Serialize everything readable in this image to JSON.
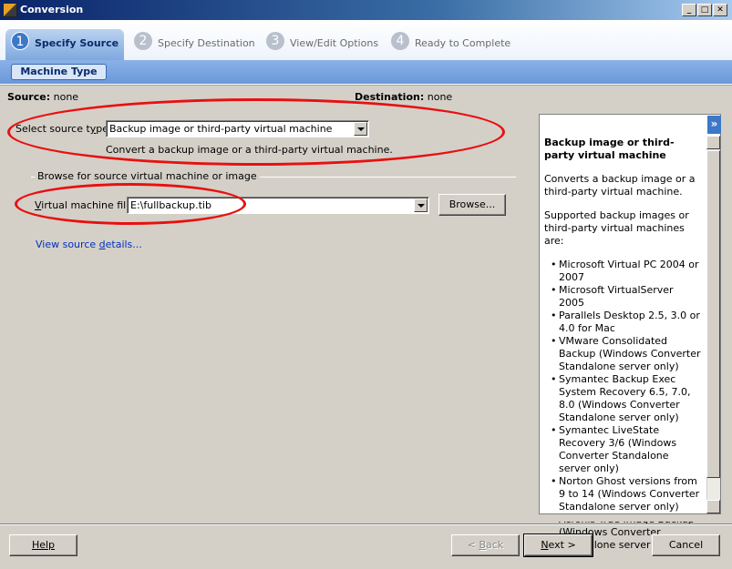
{
  "window": {
    "title": "Conversion",
    "minimize": "_",
    "maximize": "□",
    "close": "✕"
  },
  "steps": [
    {
      "number": "1",
      "label": "Specify Source",
      "active": true
    },
    {
      "number": "2",
      "label": "Specify Destination",
      "active": false
    },
    {
      "number": "3",
      "label": "View/Edit Options",
      "active": false
    },
    {
      "number": "4",
      "label": "Ready to Complete",
      "active": false
    }
  ],
  "subtab": {
    "label": "Machine Type"
  },
  "summary": {
    "source_label": "Source:",
    "source_value": "none",
    "destination_label": "Destination:",
    "destination_value": "none"
  },
  "source_type": {
    "label_prefix": "Select source t",
    "label_underline": "y",
    "label_suffix": "pe:",
    "value": "Backup image or third-party virtual machine",
    "description": "Convert a backup image or a third-party virtual machine."
  },
  "browse_group": {
    "title": "Browse for source virtual machine or image",
    "file_label_underline": "V",
    "file_label_rest": "irtual machine file:",
    "file_value": "E:\\fullbackup.tib",
    "browse_button": "Browse..."
  },
  "details_link": {
    "prefix": "View source ",
    "underline": "d",
    "suffix": "etails..."
  },
  "help_panel": {
    "collapse_icon": "»",
    "title": "Backup image or third-party virtual machine",
    "intro": "Converts a backup image or a third-party virtual machine.",
    "supported_heading": "Supported backup images or third-party virtual machines are:",
    "items": [
      "Microsoft Virtual PC 2004 or 2007",
      "Microsoft VirtualServer 2005",
      "Parallels Desktop 2.5, 3.0 or 4.0 for Mac",
      "VMware Consolidated Backup (Windows Converter Standalone server only)",
      "Symantec Backup Exec System Recovery 6.5, 7.0, 8.0 (Windows Converter Standalone server only)",
      "Symantec LiveState Recovery 3/6 (Windows Converter Standalone server only)",
      "Norton Ghost versions from 9 to 14 (Windows Converter Standalone server only)",
      "Acronis True Image Backup (Windows Converter Standalone server only)"
    ]
  },
  "footer": {
    "help": "Help",
    "back_prefix": "< ",
    "back_underline": "B",
    "back_suffix": "ack",
    "next_underline": "N",
    "next_suffix": "ext >",
    "cancel": "Cancel"
  },
  "colors": {
    "annotation_ring": "#e81010",
    "active_step": "#3c78c8",
    "link": "#0030c0"
  }
}
